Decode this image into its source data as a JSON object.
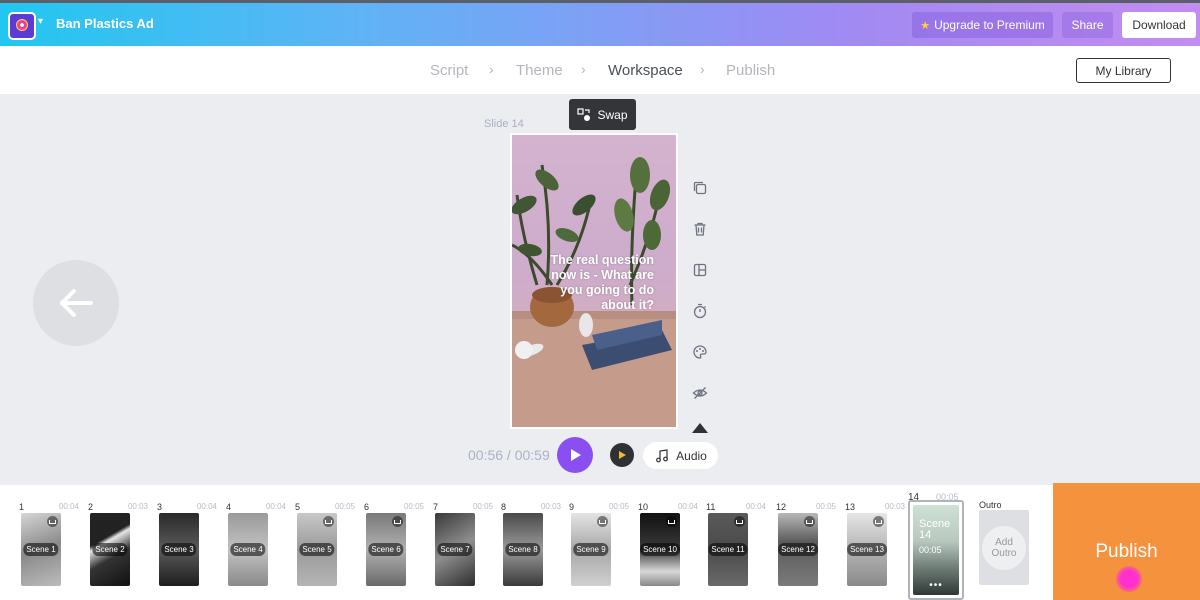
{
  "header": {
    "app_title": "Ban Plastics Ad",
    "upgrade_label": "Upgrade to Premium",
    "share_label": "Share",
    "download_label": "Download",
    "brand_color": "#5a3bd6"
  },
  "steps": {
    "items": [
      "Script",
      "Theme",
      "Workspace",
      "Publish"
    ],
    "active": "Workspace",
    "library_label": "My Library"
  },
  "workspace": {
    "slide_label": "Slide 14",
    "swap_label": "Swap",
    "slide_text": "The real question now is - What are you going to do about it?",
    "time_current": "00:56",
    "time_total": "00:59",
    "time_readout": "00:56 / 00:59",
    "audio_label": "Audio",
    "tools": [
      "duplicate-icon",
      "trash-icon",
      "layout-icon",
      "timer-icon",
      "palette-icon",
      "hide-icon",
      "collapse-icon"
    ]
  },
  "timeline": {
    "scenes": [
      {
        "num": "1",
        "dur": "00:04",
        "label": "Scene 1"
      },
      {
        "num": "2",
        "dur": "00:03",
        "label": "Scene 2"
      },
      {
        "num": "3",
        "dur": "00:04",
        "label": "Scene 3"
      },
      {
        "num": "4",
        "dur": "00:04",
        "label": "Scene 4"
      },
      {
        "num": "5",
        "dur": "00:05",
        "label": "Scene 5"
      },
      {
        "num": "6",
        "dur": "00:05",
        "label": "Scene 6"
      },
      {
        "num": "7",
        "dur": "00:05",
        "label": "Scene 7"
      },
      {
        "num": "8",
        "dur": "00:03",
        "label": "Scene 8"
      },
      {
        "num": "9",
        "dur": "00:05",
        "label": "Scene 9"
      },
      {
        "num": "10",
        "dur": "00:04",
        "label": "Scene 10"
      },
      {
        "num": "11",
        "dur": "00:04",
        "label": "Scene 11"
      },
      {
        "num": "12",
        "dur": "00:05",
        "label": "Scene 12"
      },
      {
        "num": "13",
        "dur": "00:03",
        "label": "Scene 13"
      }
    ],
    "active_scene": {
      "num": "14",
      "dur": "00:05",
      "label": "Scene 14",
      "time": "00:05"
    },
    "outro_label": "Outro",
    "add_outro_label": "Add Outro",
    "publish_label": "Publish",
    "publish_color": "#f5923e"
  }
}
